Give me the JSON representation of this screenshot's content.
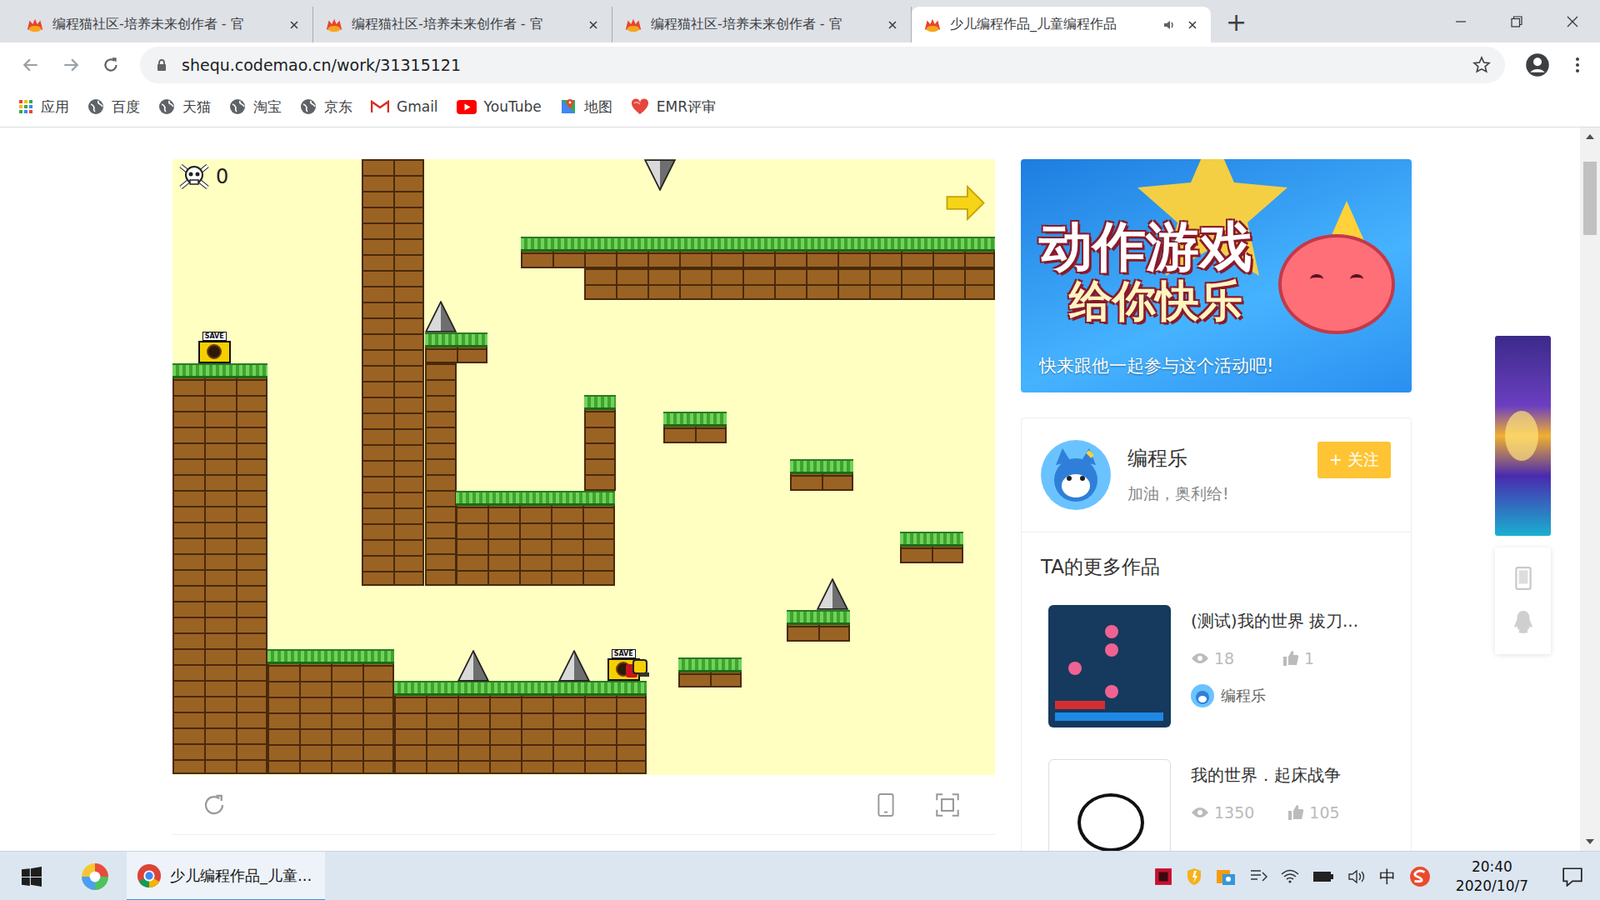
{
  "window": {
    "new_tab": "+",
    "tabs": [
      {
        "label": "编程猫社区-培养未来创作者 - 官",
        "selected": false,
        "audio": false
      },
      {
        "label": "编程猫社区-培养未来创作者 - 官",
        "selected": false,
        "audio": false
      },
      {
        "label": "编程猫社区-培养未来创作者 - 官",
        "selected": false,
        "audio": false
      },
      {
        "label": "少儿编程作品_儿童编程作品",
        "selected": true,
        "audio": true
      }
    ]
  },
  "address_bar": {
    "url": "shequ.codemao.cn/work/31315121",
    "bookmarked": false
  },
  "bookmarks": [
    {
      "label": "应用",
      "kind": "apps"
    },
    {
      "label": "百度",
      "kind": "globe"
    },
    {
      "label": "天猫",
      "kind": "globe"
    },
    {
      "label": "淘宝",
      "kind": "globe"
    },
    {
      "label": "京东",
      "kind": "globe"
    },
    {
      "label": "Gmail",
      "kind": "gmail"
    },
    {
      "label": "YouTube",
      "kind": "youtube"
    },
    {
      "label": "地图",
      "kind": "maps"
    },
    {
      "label": "EMR评审",
      "kind": "heart"
    }
  ],
  "game": {
    "deaths": "0",
    "save_label": "SAVE"
  },
  "banner": {
    "title": "动作游戏",
    "subtitle": "给你快乐",
    "caption": "快来跟他一起参与这个活动吧!"
  },
  "author": {
    "name": "编程乐",
    "motto": "加油，奥利给!",
    "follow": "+ 关注"
  },
  "more_works": {
    "title": "TA的更多作品",
    "items": [
      {
        "title": "(测试)我的世界 拔刀...",
        "views": "18",
        "likes": "1",
        "author": "编程乐"
      },
      {
        "title": "我的世界．起床战争",
        "views": "1350",
        "likes": "105"
      }
    ]
  },
  "taskbar": {
    "app": "少儿编程作品_儿童...",
    "ime": "中",
    "time": "20:40",
    "date": "2020/10/7"
  }
}
